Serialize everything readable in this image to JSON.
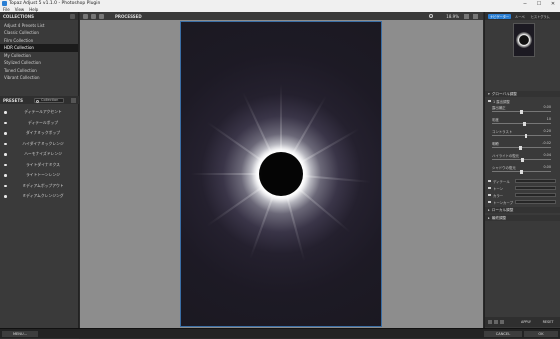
{
  "window": {
    "title": "Topaz Adjust 5 v1.1.0 - Photoshop Plugin",
    "minimize": "─",
    "maximize": "☐",
    "close": "✕"
  },
  "menu": [
    "File",
    "View",
    "Help"
  ],
  "collections": {
    "header": "COLLECTIONS",
    "items": [
      "Adjust 4 Presets List",
      "Classic Collection",
      "Film Collection",
      "HDR Collection",
      "My Collection",
      "Stylized Collection",
      "Toned Collection",
      "Vibrant Collection"
    ],
    "selected_index": 3
  },
  "presets": {
    "header": "PRESETS",
    "filter": "Collection",
    "items": [
      "ディテールアクセント",
      "ディテールポップ",
      "ダイナミックポップ",
      "ハイダイナミックレンジ",
      "ハーモナイズドレンジ",
      "ライトダイナミクス",
      "ライトトーンレンジ",
      "ミディアムポップアウト",
      "ミディアムクレンジング"
    ]
  },
  "toolbar": {
    "mode": "PROCESSED",
    "zoom": "18.9%"
  },
  "right_panel": {
    "tabs": [
      "ナビゲーター",
      "ルーペ",
      "ヒストグラム"
    ],
    "active_tab": 0,
    "section_global": "グローバル調整",
    "sub_check": "1 露出調整",
    "sliders": [
      {
        "label": "露出補正",
        "value": "0.00",
        "fraction": 0.5
      },
      {
        "label": "彩度",
        "value": "10",
        "fraction": 0.55
      },
      {
        "label": "コントラスト",
        "value": "0.20",
        "fraction": 0.58
      },
      {
        "label": "明瞭",
        "value": "-0.02",
        "fraction": 0.48
      },
      {
        "label": "ハイライトの復元",
        "value": "0.04",
        "fraction": 0.52
      },
      {
        "label": "シャドウの復元",
        "value": "0.00",
        "fraction": 0.5
      }
    ],
    "sub_options": [
      "ディテール",
      "トーン",
      "カラー",
      "トーンカーブ"
    ],
    "sections_collapsed": [
      "ローカル調整",
      "最終調整"
    ],
    "apply": "APPLY",
    "reset": "RESET"
  },
  "bottom": {
    "menu": "MENU...",
    "cancel": "CANCEL",
    "ok": "OK"
  }
}
